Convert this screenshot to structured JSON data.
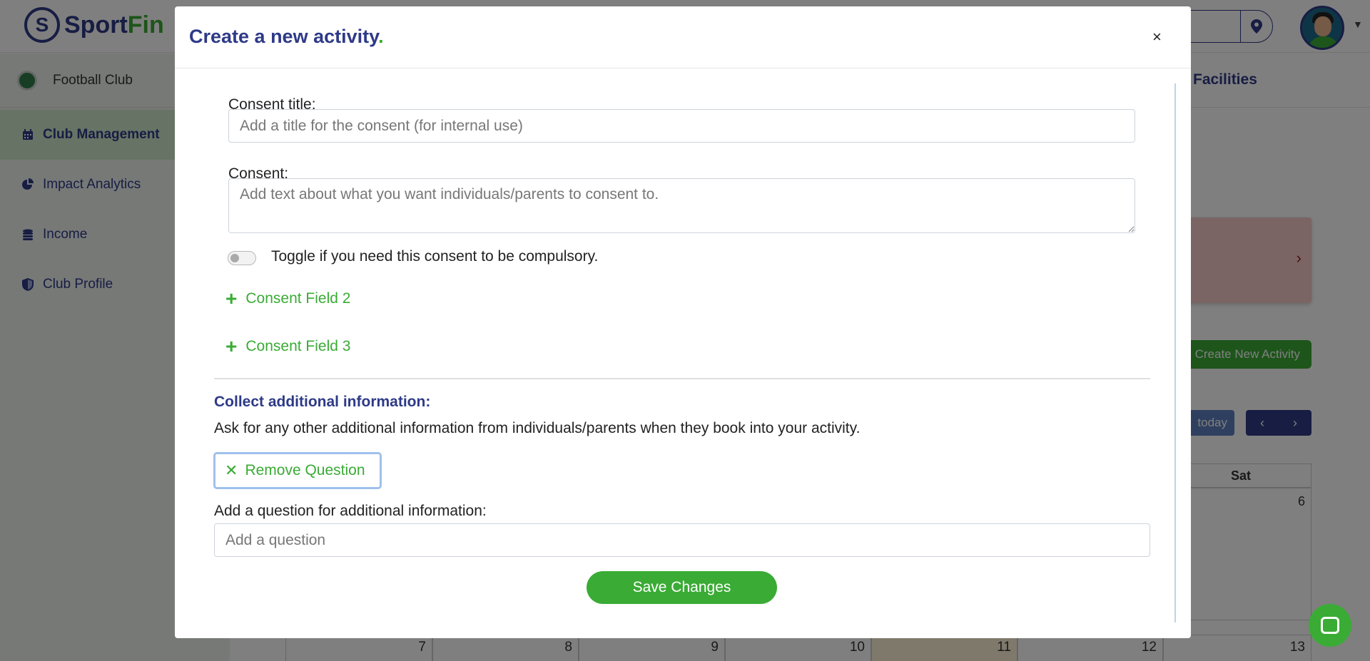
{
  "app": {
    "logo_letter": "S",
    "logo_sport": "Sport",
    "logo_fin": "Fin",
    "club_name": "Football Club",
    "header_tab": "Facilities"
  },
  "sidebar": {
    "items": [
      {
        "label": "Club Management",
        "icon": "calendar-icon"
      },
      {
        "label": "Impact Analytics",
        "icon": "pie-chart-icon"
      },
      {
        "label": "Income",
        "icon": "coins-icon"
      },
      {
        "label": "Club Profile",
        "icon": "shield-icon"
      }
    ]
  },
  "background": {
    "create_activity_label": "Create New Activity",
    "today_label": "today",
    "calendar_day_header": "Sat",
    "calendar_week1": {
      "sat": "6"
    },
    "calendar_week2": [
      "7",
      "8",
      "9",
      "10",
      "11",
      "12",
      "13"
    ]
  },
  "modal": {
    "title": "Create a new activity",
    "title_dot": ".",
    "close_label": "×",
    "consent_title_label": "Consent title:",
    "consent_title_placeholder": "Add a title for the consent (for internal use)",
    "consent_label": "Consent:",
    "consent_placeholder": "Add text about what you want individuals/parents to consent to.",
    "toggle_text": "Toggle if you need this consent to be compulsory.",
    "toggle_on": false,
    "consent_field_2": "Consent Field 2",
    "consent_field_3": "Consent Field 3",
    "section_title": "Collect additional information:",
    "section_desc": "Ask for any other additional information from individuals/parents when they book into your activity.",
    "remove_question_label": "Remove Question",
    "question_label": "Add a question for additional information:",
    "question_placeholder": "Add a question",
    "save_label": "Save Changes"
  },
  "colors": {
    "brand_navy": "#2e3a87",
    "brand_green": "#3aab35"
  }
}
